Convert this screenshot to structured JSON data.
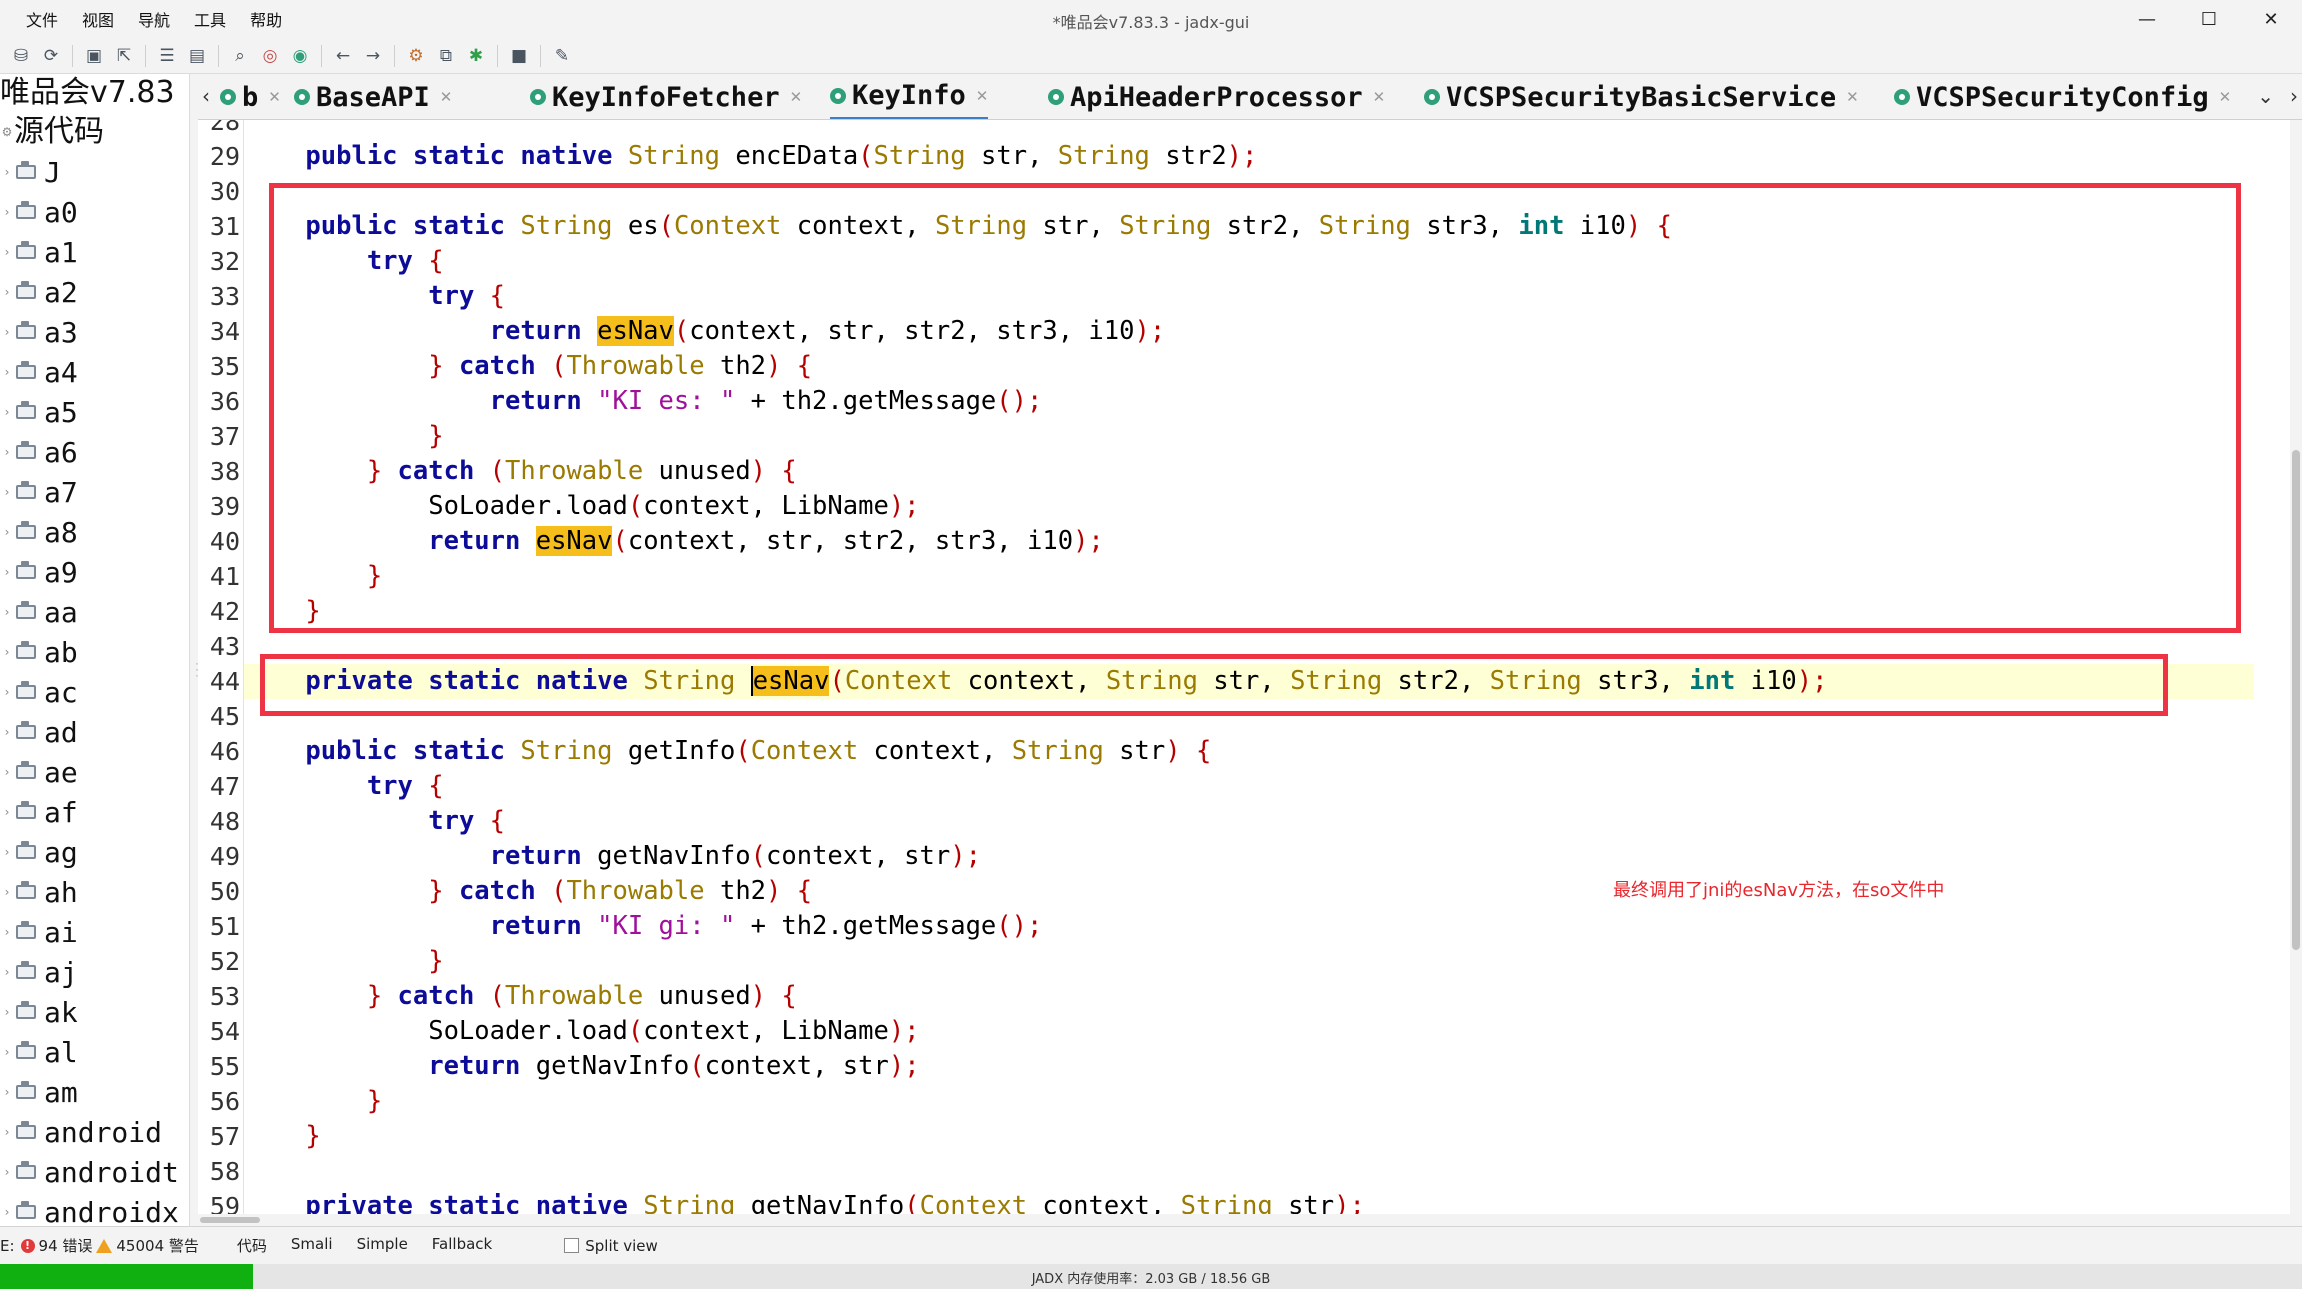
{
  "window": {
    "title": "*唯品会v7.83.3 - jadx-gui"
  },
  "menu": [
    "文件",
    "视图",
    "导航",
    "工具",
    "帮助"
  ],
  "window_controls": [
    "—",
    "☐",
    "✕"
  ],
  "toolbar_icons": [
    "save-all-icon",
    "sync-icon",
    "save-icon",
    "export-icon",
    "flatten-icon",
    "package-icon",
    "search-icon",
    "find-usage-icon",
    "find-class-icon",
    "back-icon",
    "forward-icon",
    "decompile-icon",
    "bookmark-icon",
    "debug-icon",
    "log-icon",
    "settings-icon"
  ],
  "sidebar": {
    "root": "唯品会v7.83",
    "source_label": "源代码",
    "packages": [
      "J",
      "a0",
      "a1",
      "a2",
      "a3",
      "a4",
      "a5",
      "a6",
      "a7",
      "a8",
      "a9",
      "aa",
      "ab",
      "ac",
      "ad",
      "ae",
      "af",
      "ag",
      "ah",
      "ai",
      "aj",
      "ak",
      "al",
      "am",
      "android",
      "androidt",
      "androidx"
    ]
  },
  "tabs": [
    {
      "label": "b",
      "active": false
    },
    {
      "label": "BaseAPI",
      "active": false
    },
    {
      "label": "KeyInfoFetcher",
      "active": false
    },
    {
      "label": "KeyInfo",
      "active": true
    },
    {
      "label": "ApiHeaderProcessor",
      "active": false
    },
    {
      "label": "VCSPSecurityBasicService",
      "active": false
    },
    {
      "label": "VCSPSecurityConfig",
      "active": false
    }
  ],
  "editor": {
    "top_partial_line": "28",
    "highlighted_line": 44,
    "lines": [
      {
        "no": "29",
        "code": "    public static native String encEData(String str, String str2);"
      },
      {
        "no": "30",
        "code": ""
      },
      {
        "no": "31",
        "code": "    public static String es(Context context, String str, String str2, String str3, int i10) {"
      },
      {
        "no": "32",
        "code": "        try {"
      },
      {
        "no": "33",
        "code": "            try {"
      },
      {
        "no": "34",
        "code": "                return esNav(context, str, str2, str3, i10);"
      },
      {
        "no": "35",
        "code": "            } catch (Throwable th2) {"
      },
      {
        "no": "36",
        "code": "                return \"KI es: \" + th2.getMessage();"
      },
      {
        "no": "37",
        "code": "            }"
      },
      {
        "no": "38",
        "code": "        } catch (Throwable unused) {"
      },
      {
        "no": "39",
        "code": "            SoLoader.load(context, LibName);"
      },
      {
        "no": "40",
        "code": "            return esNav(context, str, str2, str3, i10);"
      },
      {
        "no": "41",
        "code": "        }"
      },
      {
        "no": "42",
        "code": "    }"
      },
      {
        "no": "43",
        "code": ""
      },
      {
        "no": "44",
        "code": "    private static native String esNav(Context context, String str, String str2, String str3, int i10);"
      },
      {
        "no": "45",
        "code": ""
      },
      {
        "no": "46",
        "code": "    public static String getInfo(Context context, String str) {"
      },
      {
        "no": "47",
        "code": "        try {"
      },
      {
        "no": "48",
        "code": "            try {"
      },
      {
        "no": "49",
        "code": "                return getNavInfo(context, str);"
      },
      {
        "no": "50",
        "code": "            } catch (Throwable th2) {"
      },
      {
        "no": "51",
        "code": "                return \"KI gi: \" + th2.getMessage();"
      },
      {
        "no": "52",
        "code": "            }"
      },
      {
        "no": "53",
        "code": "        } catch (Throwable unused) {"
      },
      {
        "no": "54",
        "code": "            SoLoader.load(context, LibName);"
      },
      {
        "no": "55",
        "code": "            return getNavInfo(context, str);"
      },
      {
        "no": "56",
        "code": "        }"
      },
      {
        "no": "57",
        "code": "    }"
      },
      {
        "no": "58",
        "code": ""
      },
      {
        "no": "59",
        "code": "    private static native String getNavInfo(Context context, String str);"
      }
    ],
    "annotation": "最终调用了jni的esNav方法，在so文件中",
    "highlight_word": "esNav"
  },
  "statusbar": {
    "prefix": "E:",
    "errors": "94 错误",
    "warnings": "45004 警告",
    "view_tabs": [
      "代码",
      "Smali",
      "Simple",
      "Fallback"
    ],
    "split_view": "Split view"
  },
  "memory": {
    "text": "JADX 内存使用率：2.03 GB / 18.56 GB",
    "used_fraction": 0.11
  },
  "colors": {
    "keyword": "#0c0c99",
    "type": "#9a7a00",
    "paren": "#b50000",
    "string": "#a0109a",
    "annotation_red": "#e8262c",
    "box_red": "#ee3344",
    "highlight": "#f5be1a",
    "memory_bar": "#10b010"
  }
}
